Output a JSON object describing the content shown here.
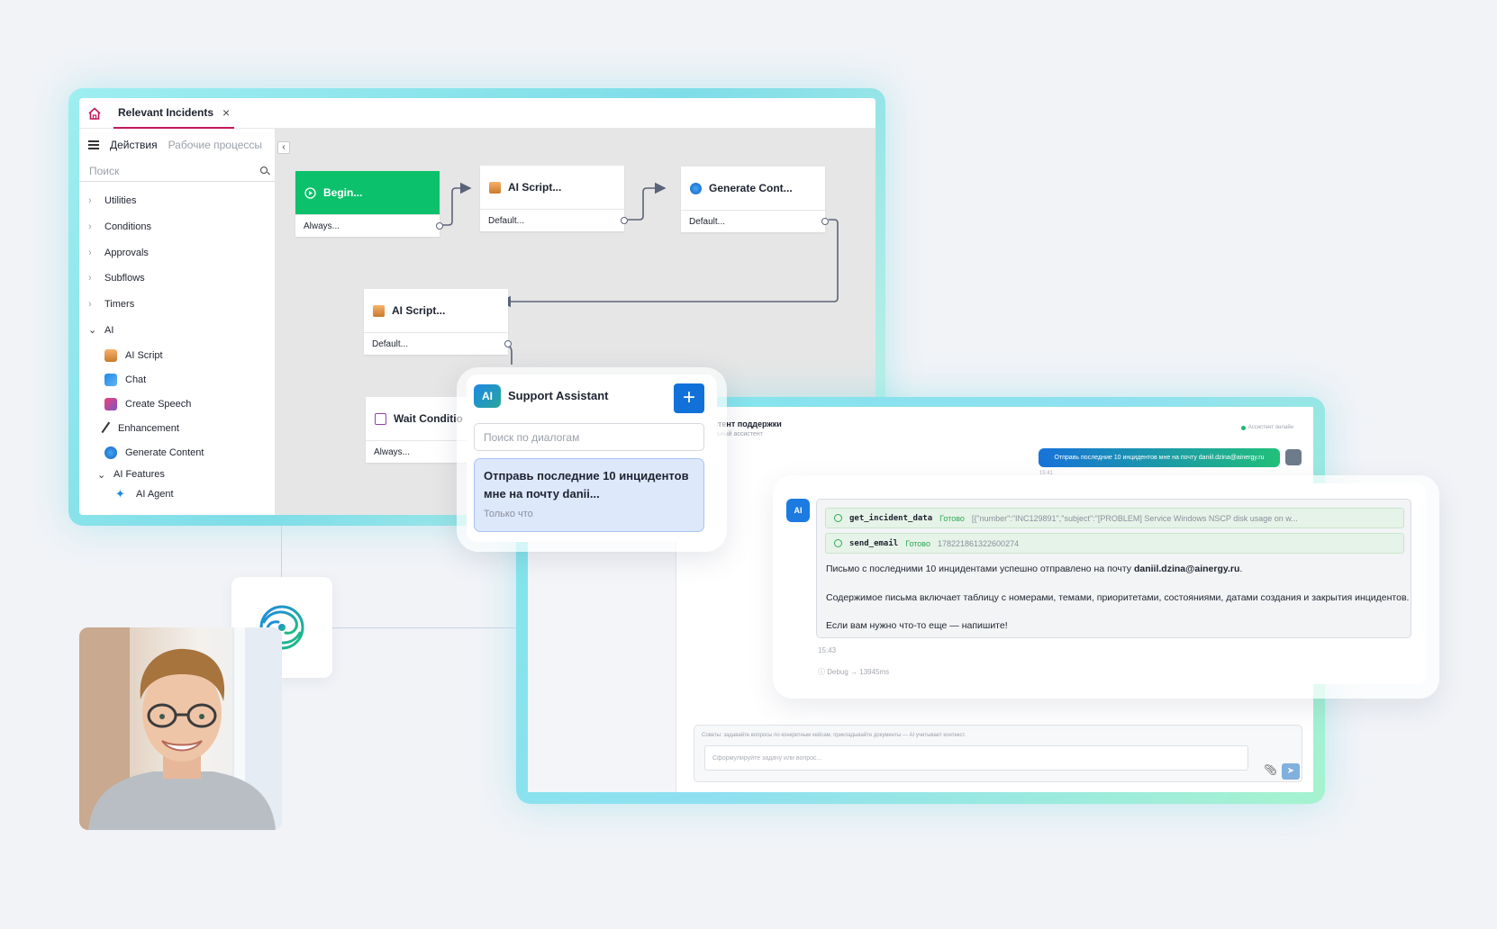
{
  "workflow": {
    "tab_title": "Relevant Incidents",
    "tab_close": "×",
    "sidebar": {
      "tab_actions": "Действия",
      "tab_processes": "Рабочие процессы",
      "search_placeholder": "Поиск",
      "categories": [
        "Utilities",
        "Conditions",
        "Approvals",
        "Subflows",
        "Timers",
        "AI"
      ],
      "ai_items": [
        "AI Script",
        "Chat",
        "Create Speech",
        "Enhancement",
        "Generate Content"
      ],
      "ai_features_label": "AI Features",
      "ai_features_items": [
        "AI Agent"
      ]
    },
    "collapse_icon": "‹",
    "nodes": {
      "begin": {
        "title": "Begin...",
        "port": "Always..."
      },
      "ai_script_1": {
        "title": "AI Script...",
        "port": "Default..."
      },
      "generate": {
        "title": "Generate Cont...",
        "port": "Default..."
      },
      "ai_script_2": {
        "title": "AI Script...",
        "port": "Default..."
      },
      "wait": {
        "title": "Wait Conditio",
        "port": "Always..."
      }
    }
  },
  "assistant": {
    "badge": "AI",
    "title": "Support Assistant",
    "add_label": "+",
    "search_placeholder": "Поиск по диалогам",
    "dialog_title": "Отправь последние 10 инцидентов мне на почту danii...",
    "dialog_time": "Только что"
  },
  "chat": {
    "header_title": "стент поддержки",
    "header_subtitle": "льный ассистент",
    "status": "Ассистент онлайн",
    "user_message": "Отправь последние 10 инцидентов мне на почту daniil.dzina@ainergy.ru",
    "user_time": "15:41",
    "answer": {
      "badge": "AI",
      "tools": [
        {
          "name": "get_incident_data",
          "status": "Готово",
          "payload": "[{\"number\":\"INC129891\",\"subject\":\"[PROBLEM] Service Windows NSCP disk usage on w..."
        },
        {
          "name": "send_email",
          "status": "Готово",
          "payload": "178221861322600274"
        }
      ],
      "line1_prefix": "Письмо с последними 10 инцидентами успешно отправлено на почту ",
      "line1_email": "daniil.dzina@ainergy.ru",
      "line1_suffix": ".",
      "line2": "Содержимое письма включает таблицу с номерами, темами, приоритетами, состояниями, датами создания и закрытия инцидентов.",
      "line3": "Если вам нужно что-то еще — напишите!",
      "time": "15:43",
      "debug": "ⓘ Debug → 13945ms"
    },
    "composer_hint": "Советы: задавайте вопросы по конкретным кейсам, прикладывайте документы — AI учитывает контекст.",
    "composer_placeholder": "Сформулируйте задачу или вопрос...",
    "attach_icon": "paperclip-icon",
    "send_icon": "send-icon"
  },
  "colors": {
    "accent_blue": "#1271d8",
    "begin_green": "#0cc16b",
    "tab_underline": "#c2185b",
    "tool_ok": "#2eaa57"
  }
}
